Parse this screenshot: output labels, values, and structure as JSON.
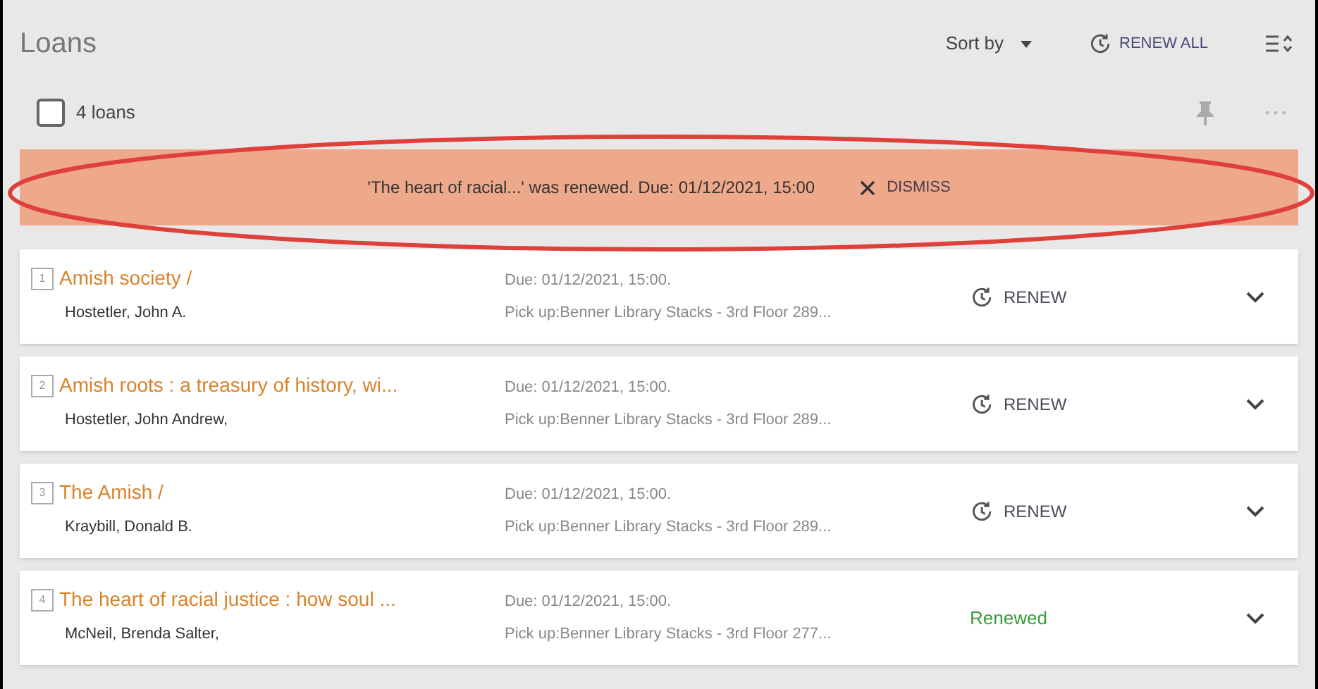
{
  "header": {
    "title": "Loans",
    "sort_label": "Sort by",
    "renew_all": "RENEW ALL"
  },
  "selection": {
    "checked": false,
    "count": "4 loans"
  },
  "banner": {
    "message": "'The heart of racial...' was renewed. Due: 01/12/2021, 15:00",
    "dismiss": "DISMISS"
  },
  "loans": [
    {
      "number": "1",
      "title": "Amish society /",
      "author": "Hostetler, John A.",
      "due": "Due: 01/12/2021, 15:00.",
      "pickup": "Pick up:Benner Library Stacks - 3rd Floor 289...",
      "kind": "renew",
      "action": "RENEW"
    },
    {
      "number": "2",
      "title": "Amish roots : a treasury of history, wi...",
      "author": "Hostetler, John Andrew,",
      "due": "Due: 01/12/2021, 15:00.",
      "pickup": "Pick up:Benner Library Stacks - 3rd Floor 289...",
      "kind": "renew",
      "action": "RENEW"
    },
    {
      "number": "3",
      "title": "The Amish /",
      "author": "Kraybill, Donald B.",
      "due": "Due: 01/12/2021, 15:00.",
      "pickup": "Pick up:Benner Library Stacks - 3rd Floor 289...",
      "kind": "renew",
      "action": "RENEW"
    },
    {
      "number": "4",
      "title": "The heart of racial justice : how soul ...",
      "author": "McNeil, Brenda Salter,",
      "due": "Due: 01/12/2021, 15:00.",
      "pickup": "Pick up:Benner Library Stacks - 3rd Floor 277...",
      "kind": "status",
      "action": "Renewed"
    }
  ]
}
